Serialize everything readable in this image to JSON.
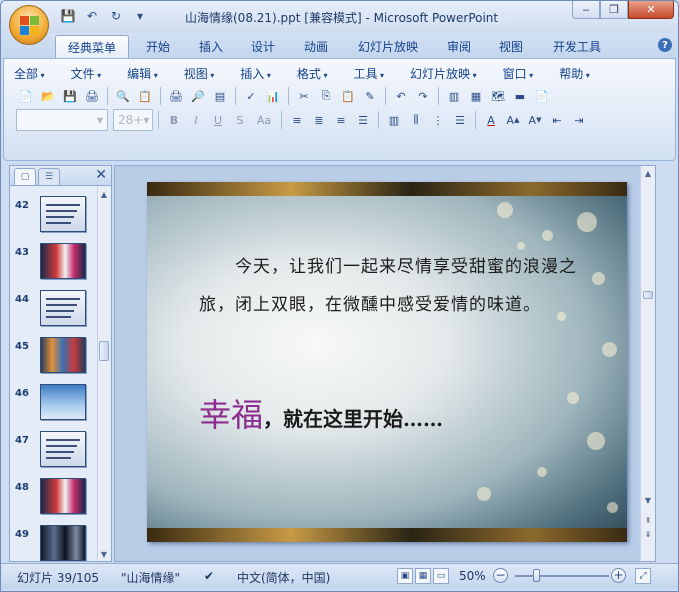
{
  "window": {
    "title": "山海情缘(08.21).ppt [兼容模式] - Microsoft PowerPoint",
    "controls": {
      "minimize": "‒",
      "restore": "❐",
      "close": "✕"
    }
  },
  "quick_access": [
    {
      "icon": "save-icon",
      "glyph": "💾"
    },
    {
      "icon": "undo-icon",
      "glyph": "↶"
    },
    {
      "icon": "redo-icon",
      "glyph": "↻"
    },
    {
      "icon": "customize-icon",
      "glyph": "▾"
    }
  ],
  "ribbon_tabs": [
    "经典菜单",
    "开始",
    "插入",
    "设计",
    "动画",
    "幻灯片放映",
    "审阅",
    "视图",
    "开发工具"
  ],
  "active_tab": 0,
  "menus": [
    "全部",
    "文件",
    "编辑",
    "视图",
    "插入",
    "格式",
    "工具",
    "幻灯片放映",
    "窗口",
    "帮助"
  ],
  "toolbar_row1": [
    "📄",
    "📂",
    "💾",
    "🖨",
    "🔍",
    "📋",
    "🖨",
    "🔎",
    "▤",
    "✓",
    "📊",
    "✂",
    "⎘",
    "📋",
    "✎",
    "↶",
    "↷",
    "▥",
    "▦",
    "🗺",
    "▬",
    "📄"
  ],
  "font_combo": {
    "name": "",
    "size": "28+"
  },
  "format_buttons": [
    "B",
    "I",
    "U",
    "S",
    "Aa"
  ],
  "align_buttons": [
    "≡",
    "≣",
    "≡",
    "☰"
  ],
  "pane": {
    "thumbs": [
      {
        "num": "42",
        "style": "text"
      },
      {
        "num": "43",
        "style": "photo-red"
      },
      {
        "num": "44",
        "style": "text"
      },
      {
        "num": "45",
        "style": "photo-mix"
      },
      {
        "num": "46",
        "style": "sky"
      },
      {
        "num": "47",
        "style": "text"
      },
      {
        "num": "48",
        "style": "photo-red"
      },
      {
        "num": "49",
        "style": "photo-dark"
      }
    ]
  },
  "slide": {
    "paragraph": "　　今天，让我们一起来尽情享受甜蜜的浪漫之旅，闭上双眼，在微醺中感受爱情的味道。",
    "happy_big": "幸福",
    "happy_rest": "，就在这里开始……"
  },
  "status": {
    "slide_info": "幻灯片 39/105",
    "theme": "\"山海情缘\"",
    "language": "中文(简体，中国)",
    "zoom": "50%"
  },
  "colors": {
    "accent": "#15428b",
    "happy": "#8b2a8f"
  }
}
